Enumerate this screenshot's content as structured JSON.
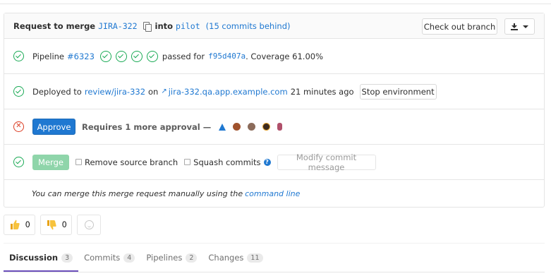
{
  "header": {
    "request_to_merge": "Request to merge",
    "source_branch": "JIRA-322",
    "into": "into",
    "target_branch": "pilot",
    "commits_behind": "(15 commits behind)",
    "checkout_button": "Check out branch"
  },
  "pipeline": {
    "label": "Pipeline",
    "id": "#6323",
    "passed_for": "passed for",
    "commit_sha": "f95d407a",
    "coverage": ". Coverage 61.00%",
    "stage_count": 4
  },
  "deployment": {
    "deployed_to": "Deployed to",
    "environment": "review/jira-332",
    "on": "on",
    "url": "jira-332.qa.app.example.com",
    "time_ago": "21 minutes ago",
    "stop_button": "Stop environment"
  },
  "approval": {
    "approve_button": "Approve",
    "requirement": "Requires 1 more approval —",
    "approver_avatar_colors": [
      "#1f78d1",
      "#a0522d",
      "#8b6b5a",
      "#3d2b1f",
      "#b0506a"
    ]
  },
  "merge": {
    "merge_button": "Merge",
    "remove_source": "Remove source branch",
    "squash": "Squash commits",
    "modify_message": "Modify commit message"
  },
  "manual_merge": {
    "text": "You can merge this merge request manually using the",
    "link": "command line"
  },
  "awards": {
    "thumbs_up": "0",
    "thumbs_down": "0"
  },
  "tabs": [
    {
      "label": "Discussion",
      "count": "3"
    },
    {
      "label": "Commits",
      "count": "4"
    },
    {
      "label": "Pipelines",
      "count": "2"
    },
    {
      "label": "Changes",
      "count": "11"
    }
  ],
  "colors": {
    "success": "#1aaa55",
    "failure": "#db3b21",
    "link": "#1f78d1",
    "active_tab": "#6b4fbb"
  }
}
